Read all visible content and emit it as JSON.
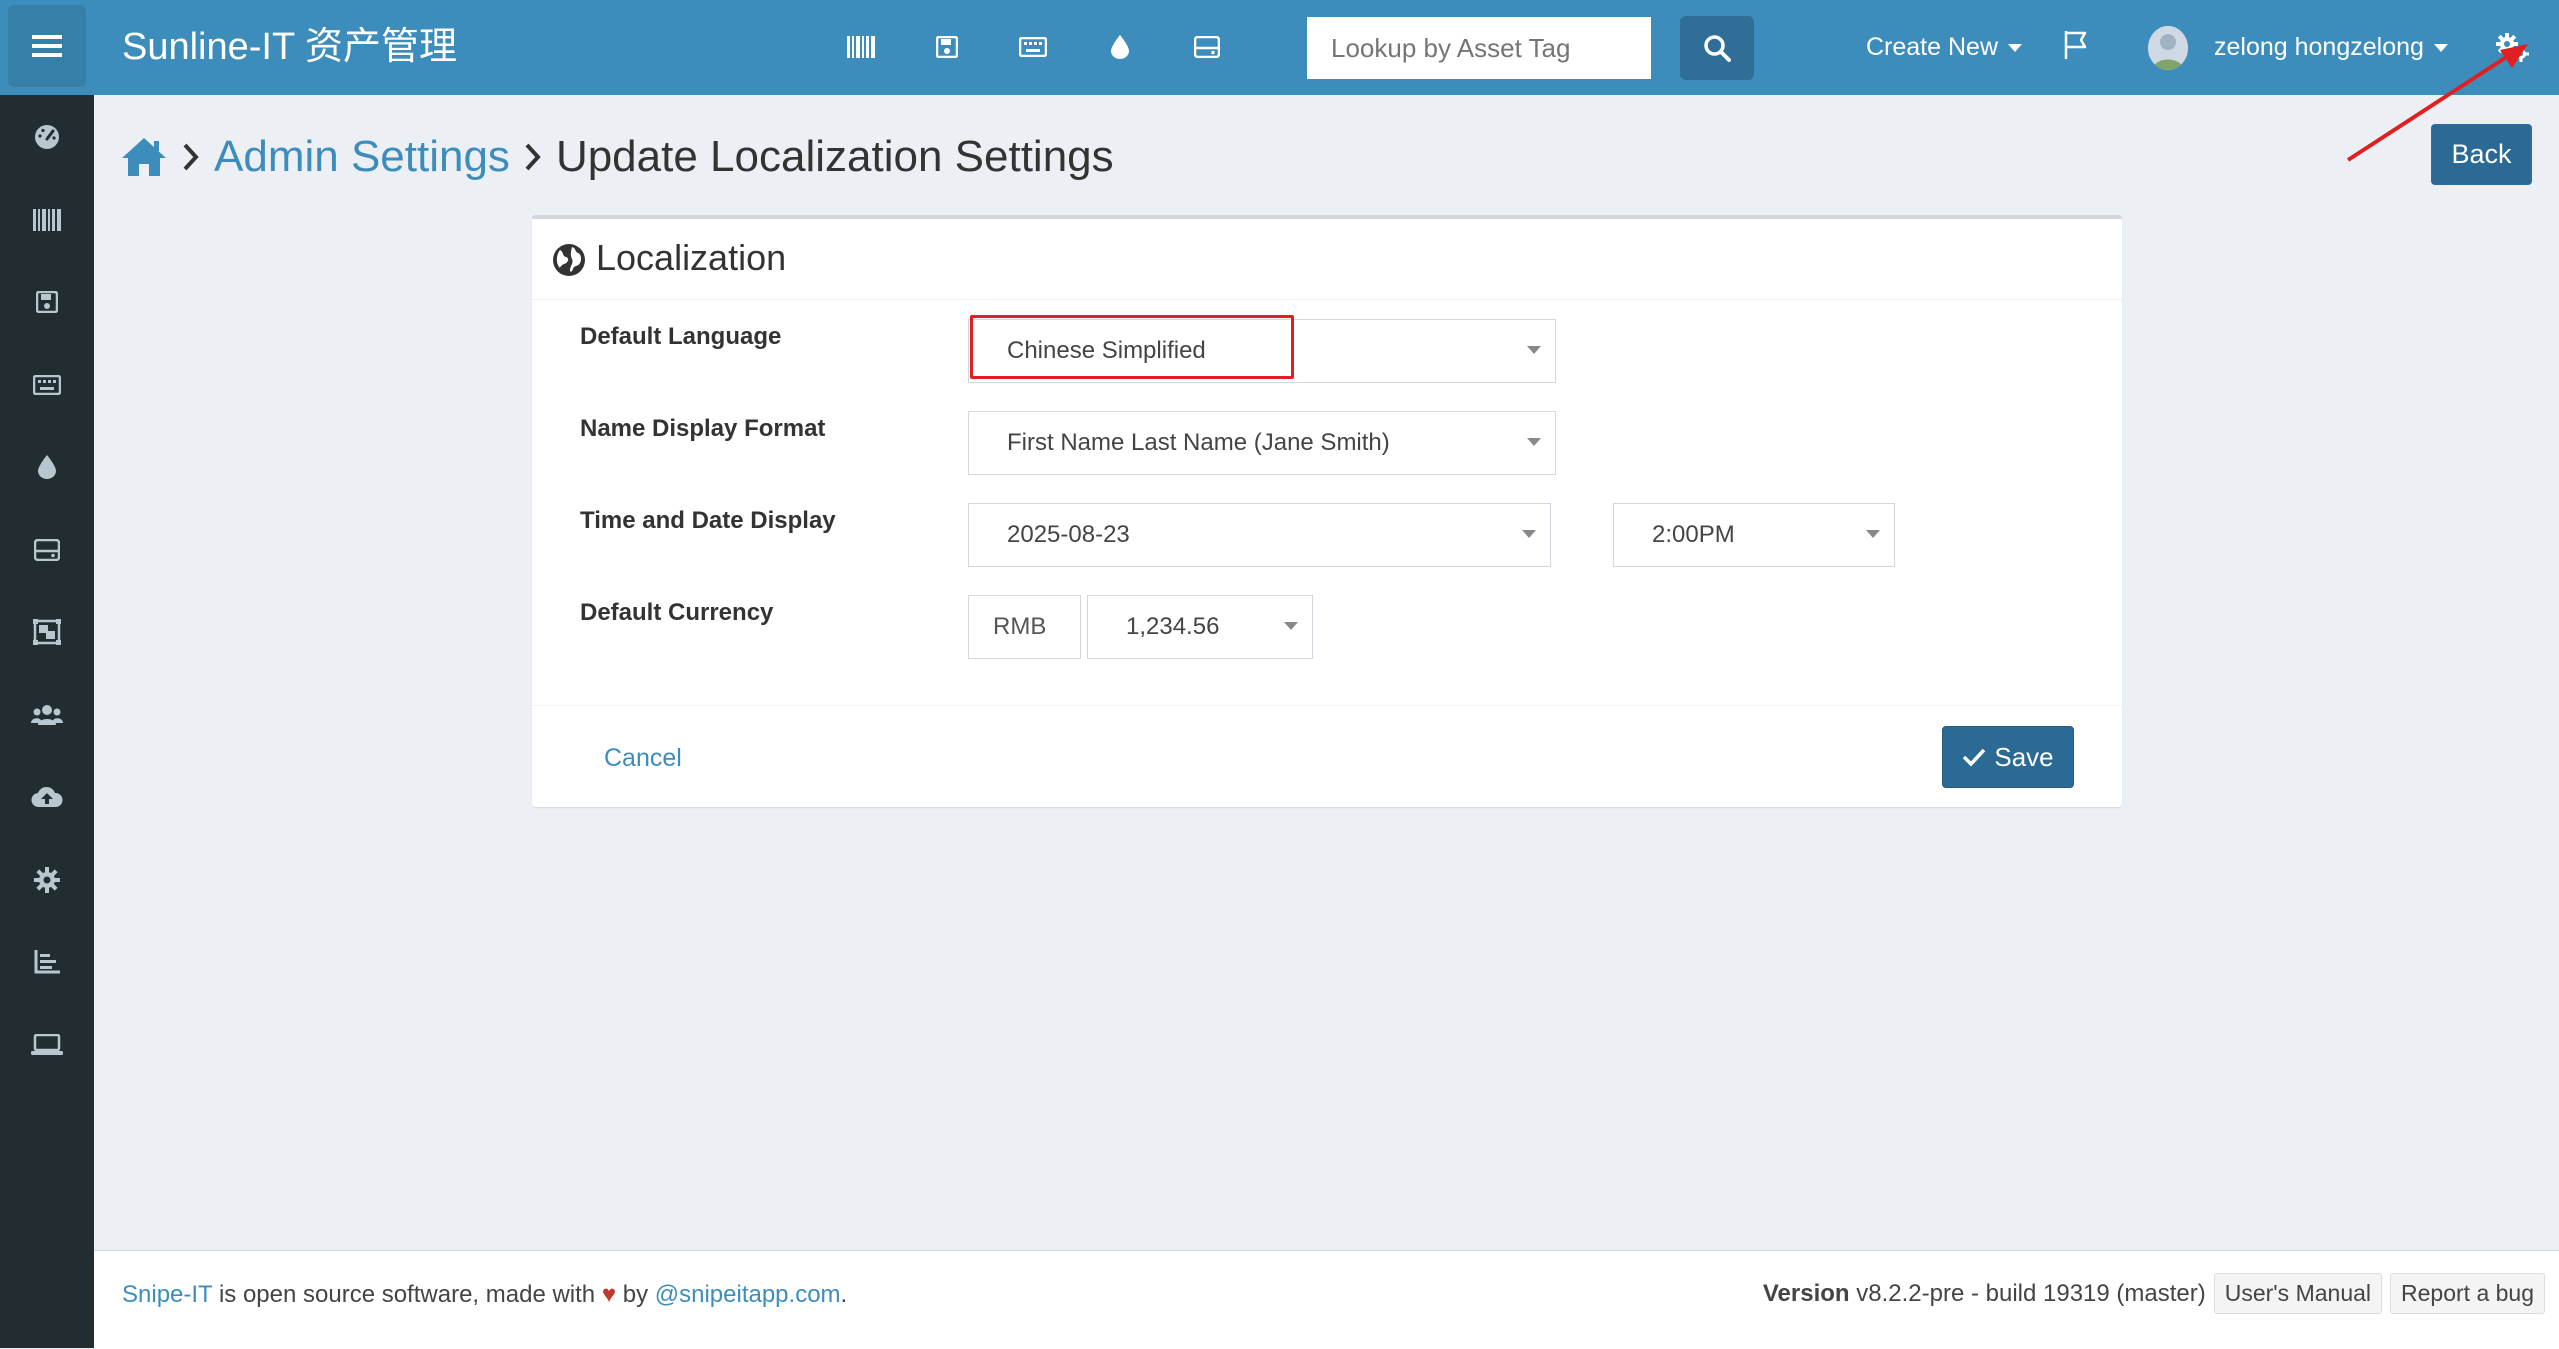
{
  "header": {
    "brand": "Sunline-IT 资产管理",
    "search_placeholder": "Lookup by Asset Tag",
    "create_new": "Create New",
    "user_name": "zelong hongzelong"
  },
  "breadcrumb": {
    "parent": "Admin Settings",
    "current": "Update Localization Settings"
  },
  "back_label": "Back",
  "card": {
    "title": "Localization",
    "fields": {
      "language": {
        "label": "Default Language",
        "value": "Chinese Simplified"
      },
      "name_format": {
        "label": "Name Display Format",
        "value": "First Name Last Name (Jane Smith)"
      },
      "datetime": {
        "label": "Time and Date Display",
        "date_value": "2025-08-23",
        "time_value": "2:00PM"
      },
      "currency": {
        "label": "Default Currency",
        "code": "RMB",
        "format": "1,234.56"
      }
    },
    "cancel_label": "Cancel",
    "save_label": "Save"
  },
  "footer": {
    "snipe_link": "Snipe-IT",
    "text1": " is open source software, made with ",
    "text2": " by ",
    "site_link": "@snipeitapp.com",
    "period": ".",
    "version_label": "Version",
    "version_value": "v8.2.2-pre - build 19319 (master)",
    "manual_label": "User's Manual",
    "bug_label": "Report a bug"
  },
  "colors": {
    "topbar": "#3c8dbc",
    "sidebar": "#222d32",
    "primary_button": "#2a6a94",
    "highlight": "#e02020",
    "heart": "#c0392b"
  }
}
